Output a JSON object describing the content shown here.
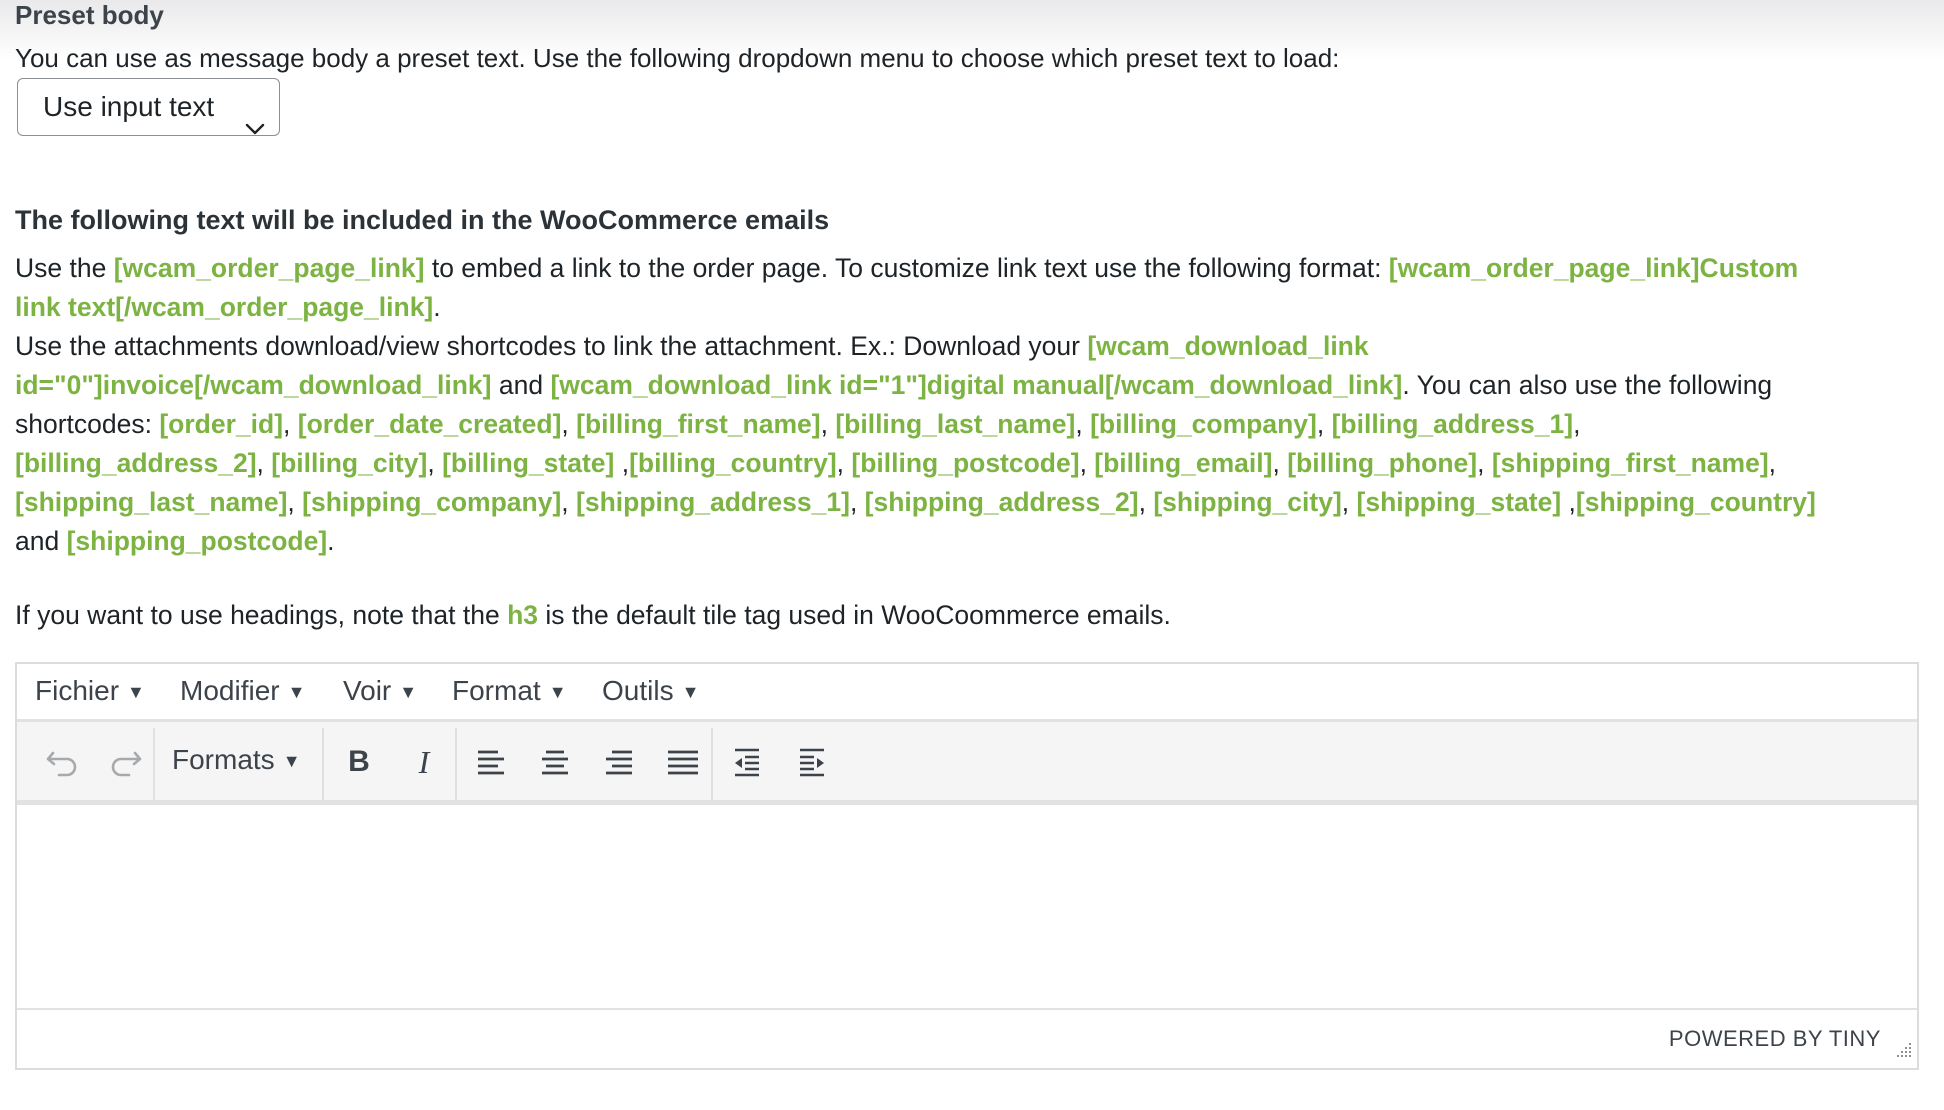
{
  "section": {
    "title": "Preset body",
    "description": "You can use as message body a preset text. Use the following dropdown menu to choose which preset text to load:",
    "preset_select": {
      "value": "Use input text"
    }
  },
  "included": {
    "heading": "The following text will be included in the WooCommerce emails",
    "line1_a": "Use the ",
    "line1_sc1": "[wcam_order_page_link]",
    "line1_b": " to embed a link to the order page. To customize link text use the following format: ",
    "line1_sc2": "[wcam_order_page_link]Custom",
    "line2_sc": "link text[/wcam_order_page_link]",
    "line2_end": ".",
    "line3_a": "Use the attachments download/view shortcodes to link the attachment. Ex.: Download your ",
    "line3_sc": "[wcam_download_link",
    "line4_sc1": "id=\"0\"]invoice[/wcam_download_link]",
    "line4_a": " and ",
    "line4_sc2": "[wcam_download_link id=\"1\"]digital manual[/wcam_download_link]",
    "line4_b": ". You can also use the following",
    "line5_a": "shortcodes: ",
    "shortcodes": [
      "[order_id]",
      "[order_date_created]",
      "[billing_first_name]",
      "[billing_last_name]",
      "[billing_company]",
      "[billing_address_1]",
      "[billing_address_2]",
      "[billing_city]",
      "[billing_state]",
      "[billing_country]",
      "[billing_postcode]",
      "[billing_email]",
      "[billing_phone]",
      "[shipping_first_name]",
      "[shipping_last_name]",
      "[shipping_company]",
      "[shipping_address_1]",
      "[shipping_address_2]",
      "[shipping_city]",
      "[shipping_state]",
      "[shipping_country]",
      "[shipping_postcode]"
    ],
    "and_word": "and ",
    "comma": ", ",
    "comma_tight": ",",
    "space_comma": " ,",
    "period": "."
  },
  "note": {
    "a": "If you want to use headings, note that the ",
    "tag": "h3",
    "b": " is the default tile tag used in WooCoommerce emails."
  },
  "editor": {
    "menu": [
      "Fichier",
      "Modifier",
      "Voir",
      "Format",
      "Outils"
    ],
    "caret": "▼",
    "formats_label": "Formats",
    "bold_label": "B",
    "italic_label": "I",
    "powered_by": "POWERED BY TINY",
    "accent_color": "#7cb342"
  }
}
